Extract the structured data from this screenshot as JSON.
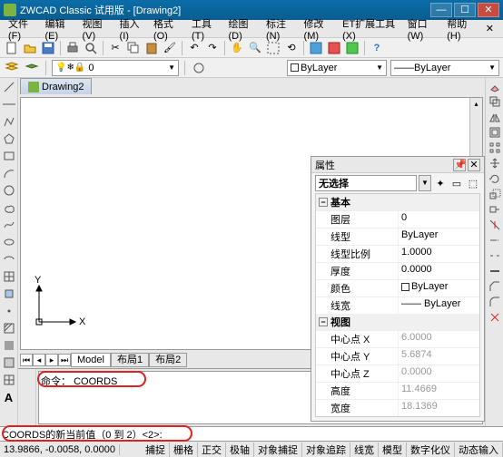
{
  "window": {
    "title": "ZWCAD Classic 试用版 - [Drawing2]"
  },
  "menus": [
    "文件(F)",
    "编辑(E)",
    "视图(V)",
    "插入(I)",
    "格式(O)",
    "工具(T)",
    "绘图(D)",
    "标注(N)",
    "修改(M)",
    "ET扩展工具(X)",
    "窗口(W)",
    "帮助(H)"
  ],
  "layer": {
    "current": "0",
    "color": "ByLayer",
    "linetype": "ByLayer"
  },
  "drawing": {
    "name": "Drawing2"
  },
  "modeltabs": {
    "items": [
      "Model",
      "布局1",
      "布局2"
    ],
    "active": 0
  },
  "prop": {
    "title": "属性",
    "selection": "无选择",
    "cats": [
      {
        "name": "基本",
        "rows": [
          {
            "k": "图层",
            "v": "0"
          },
          {
            "k": "线型",
            "v": "ByLayer"
          },
          {
            "k": "线型比例",
            "v": "1.0000"
          },
          {
            "k": "厚度",
            "v": "0.0000"
          },
          {
            "k": "颜色",
            "v": "ByLayer",
            "sw": true
          },
          {
            "k": "线宽",
            "v": "—— ByLayer"
          }
        ]
      },
      {
        "name": "视图",
        "rows": [
          {
            "k": "中心点 X",
            "v": "6.0000",
            "g": true
          },
          {
            "k": "中心点 Y",
            "v": "5.6874",
            "g": true
          },
          {
            "k": "中心点 Z",
            "v": "0.0000",
            "g": true
          },
          {
            "k": "高度",
            "v": "11.4669",
            "g": true
          },
          {
            "k": "宽度",
            "v": "18.1369",
            "g": true
          }
        ]
      }
    ]
  },
  "cmd": {
    "line1": "命令：",
    "highlight": "COORDS",
    "inputline": "COORDS的新当前值（0 到 2）<2>:"
  },
  "status": {
    "coords": "13.9866, -0.0058,  0.0000",
    "buttons": [
      "捕捉",
      "栅格",
      "正交",
      "极轴",
      "对象捕捉",
      "对象追踪",
      "线宽",
      "模型",
      "数字化仪",
      "动态输入"
    ]
  }
}
